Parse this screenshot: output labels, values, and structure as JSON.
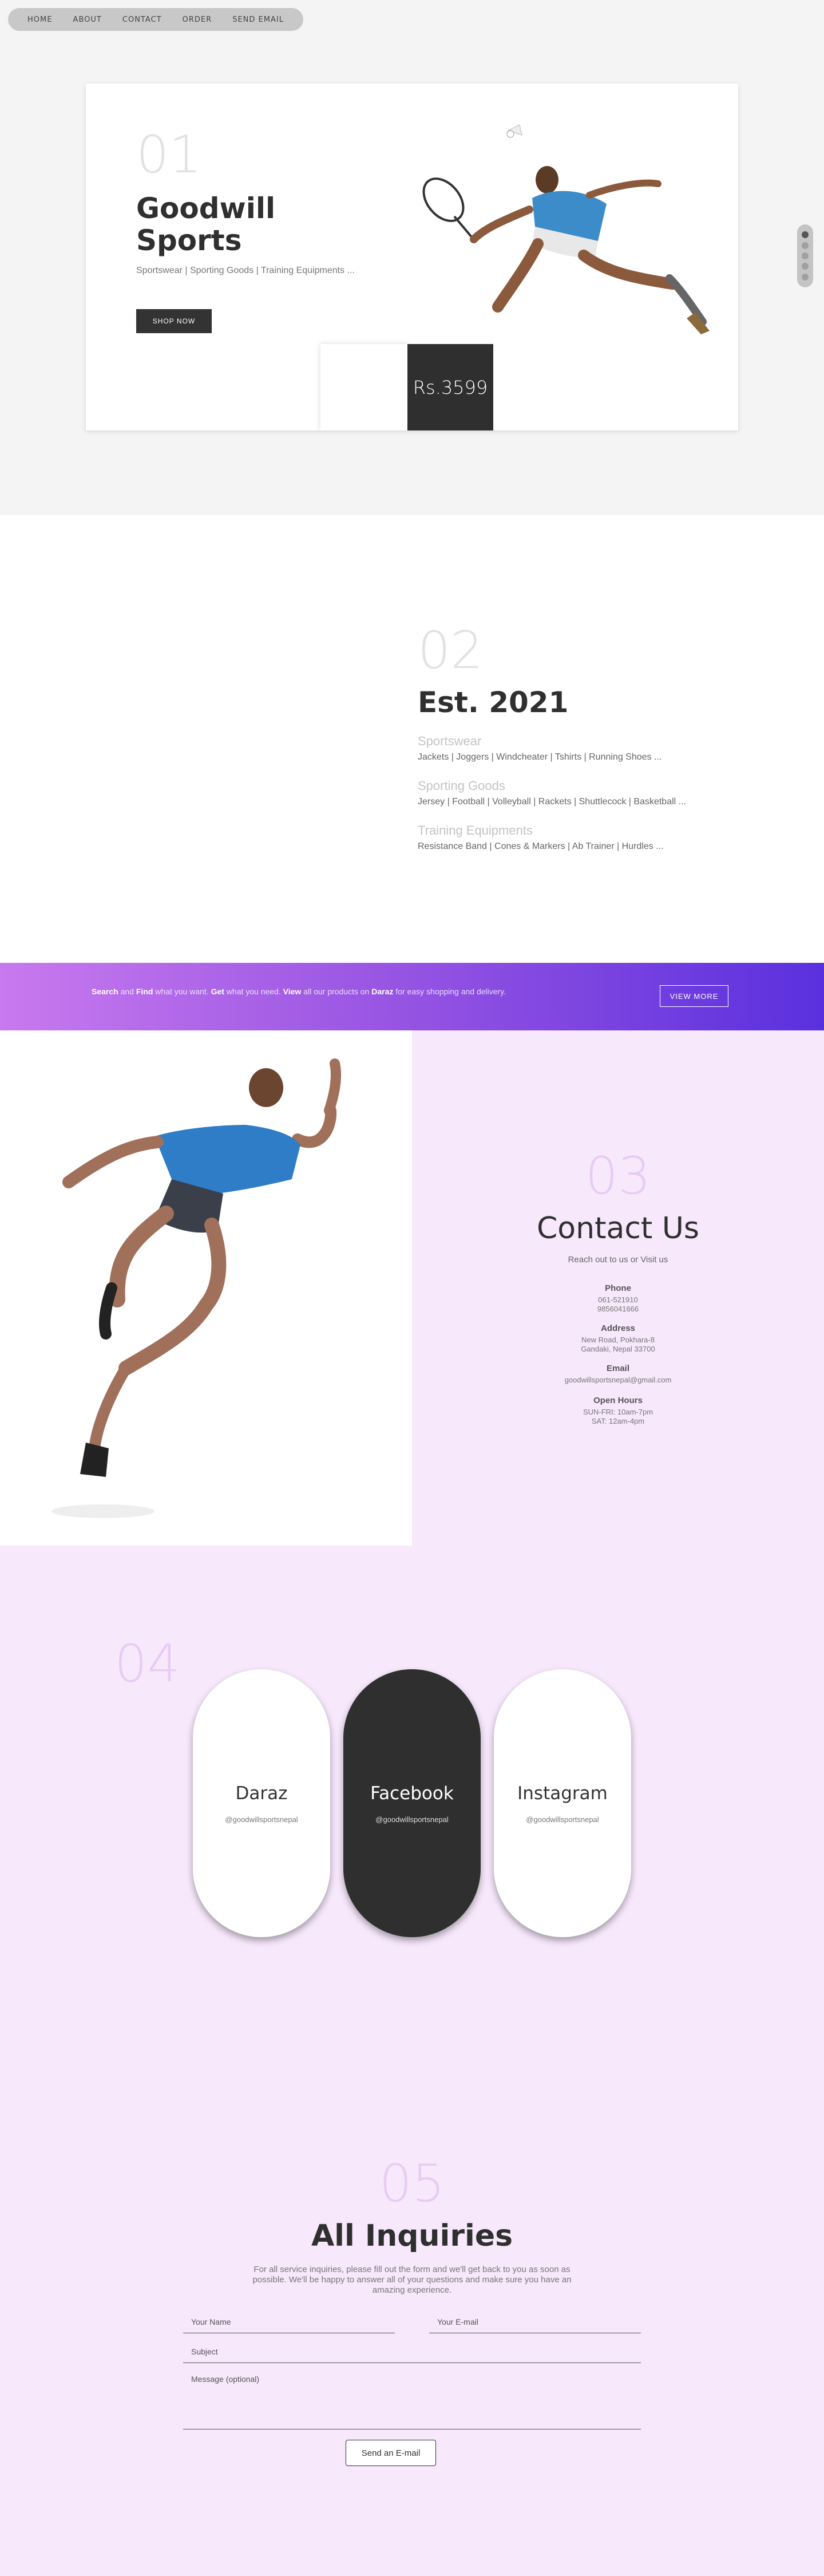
{
  "nav": {
    "items": [
      "HOME",
      "ABOUT",
      "CONTACT",
      "ORDER",
      "SEND EMAIL"
    ]
  },
  "hero": {
    "number": "01",
    "title_line1": "Goodwill",
    "title_line2": "Sports",
    "subtitle": "Sportswear | Sporting Goods | Training Equipments ...",
    "button": "SHOP NOW",
    "price": "Rs.3599",
    "slider_total": 5,
    "slider_active": 1
  },
  "about": {
    "number": "02",
    "title": "Est. 2021",
    "categories": [
      {
        "heading": "Sportswear",
        "items": "Jackets | Joggers | Windcheater | Tshirts | Running Shoes ..."
      },
      {
        "heading": "Sporting Goods",
        "items": "Jersey | Football | Volleyball | Rackets | Shuttlecock | Basketball ..."
      },
      {
        "heading": "Training Equipments",
        "items": "Resistance Band | Cones & Markers | Ab Trainer | Hurdles ..."
      }
    ]
  },
  "banner": {
    "w1": "Search",
    "t1": " and ",
    "w2": "Find",
    "t2": " what you want. ",
    "w3": "Get",
    "t3": " what you need. ",
    "w4": "View",
    "t4": " all our products on ",
    "w5": "Daraz",
    "t5": " for easy shopping and delivery.",
    "button": "VIEW MORE",
    "colors": [
      "#c879ee",
      "#5a30de"
    ]
  },
  "contact": {
    "number": "03",
    "title": "Contact Us",
    "subtitle": "Reach out to us or Visit us",
    "phone_label": "Phone",
    "phone1": "061-521910",
    "phone2": "9856041666",
    "address_label": "Address",
    "address1": "New Road, Pokhara-8",
    "address2": "Gandaki, Nepal 33700",
    "email_label": "Email",
    "email": "goodwillsportsnepal@gmail.com",
    "hours_label": "Open Hours",
    "hours1": "SUN-FRI: 10am-7pm",
    "hours2": "SAT: 12am-4pm"
  },
  "social": {
    "number": "04",
    "cards": [
      {
        "name": "Daraz",
        "handle": "@goodwillsportsnepal"
      },
      {
        "name": "Facebook",
        "handle": "@goodwillsportsnepal"
      },
      {
        "name": "Instagram",
        "handle": "@goodwillsportsnepal"
      }
    ]
  },
  "inquiry": {
    "number": "05",
    "title": "All Inquiries",
    "description": "For all service inquiries, please fill out the form and we'll get back to you as soon as possible. We'll be happy to answer all of your questions and make sure you have an amazing experience.",
    "name_placeholder": "Your Name",
    "email_placeholder": "Your E-mail",
    "subject_placeholder": "Subject",
    "message_placeholder": "Message (optional)",
    "button": "Send an E-mail"
  }
}
